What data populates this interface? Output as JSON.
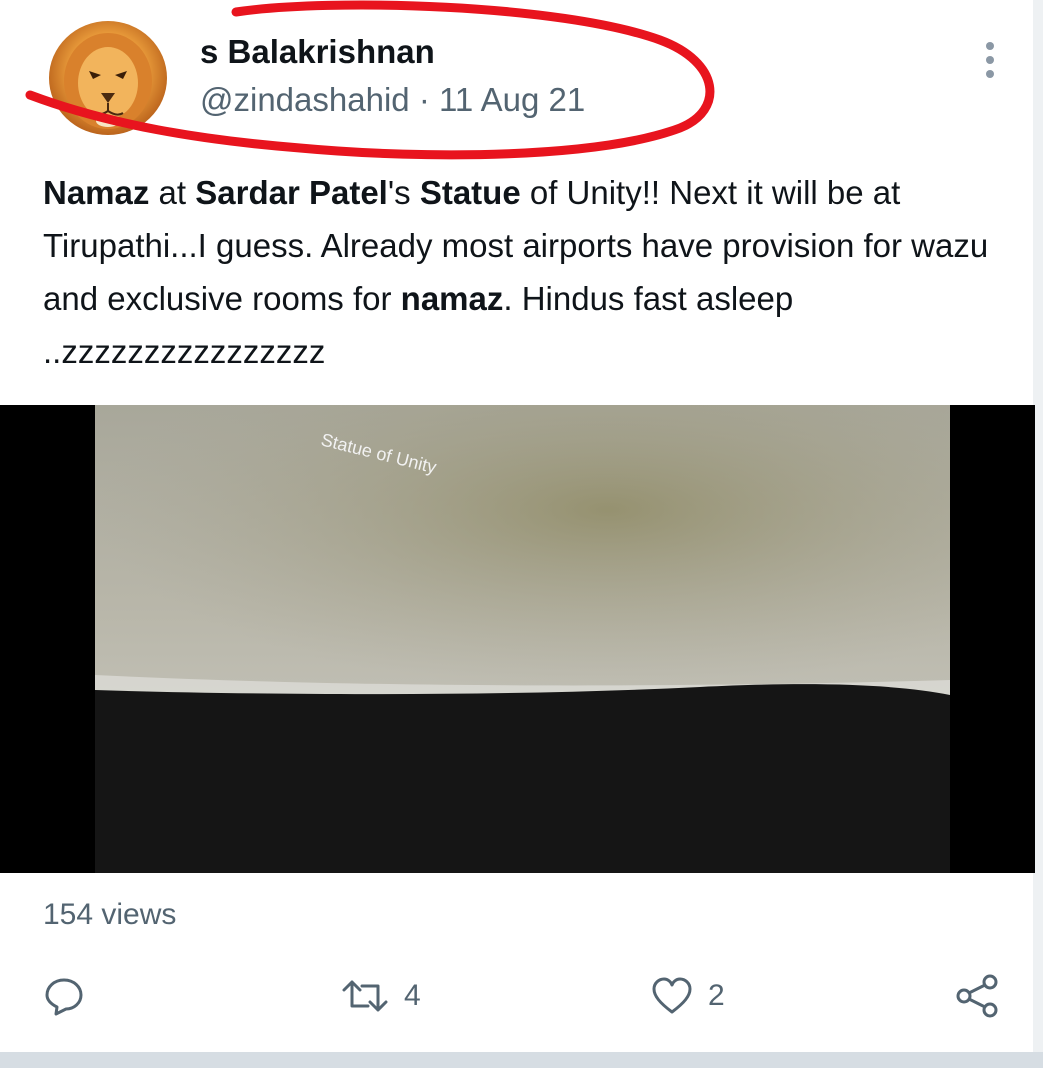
{
  "author": {
    "display_name": "s Balakrishnan",
    "handle": "@zindashahid",
    "separator": "·",
    "date": "11 Aug 21",
    "avatar_icon": "lion-avatar-icon"
  },
  "tweet": {
    "segments": [
      {
        "text": "Namaz",
        "bold": true
      },
      {
        "text": " at ",
        "bold": false
      },
      {
        "text": "Sardar Patel",
        "bold": true
      },
      {
        "text": "'s ",
        "bold": false
      },
      {
        "text": "Statue",
        "bold": true
      },
      {
        "text": " of Unity!! Next it will be at Tirupathi...I guess. Already most airports have provision for wazu and exclusive rooms for ",
        "bold": false
      },
      {
        "text": "namaz",
        "bold": true
      },
      {
        "text": ". Hindus fast asleep ..zzzzzzzzzzzzzzzz",
        "bold": false
      }
    ]
  },
  "media": {
    "overlay_text": "Statue of Unity"
  },
  "stats": {
    "views": "154 views"
  },
  "actions": {
    "reply_icon": "reply-icon",
    "retweet_icon": "retweet-icon",
    "retweet_count": "4",
    "like_icon": "heart-icon",
    "like_count": "2",
    "share_icon": "share-icon"
  },
  "colors": {
    "annotation_red": "#e8141e",
    "secondary_text": "#536471",
    "primary_text": "#0f1419"
  }
}
